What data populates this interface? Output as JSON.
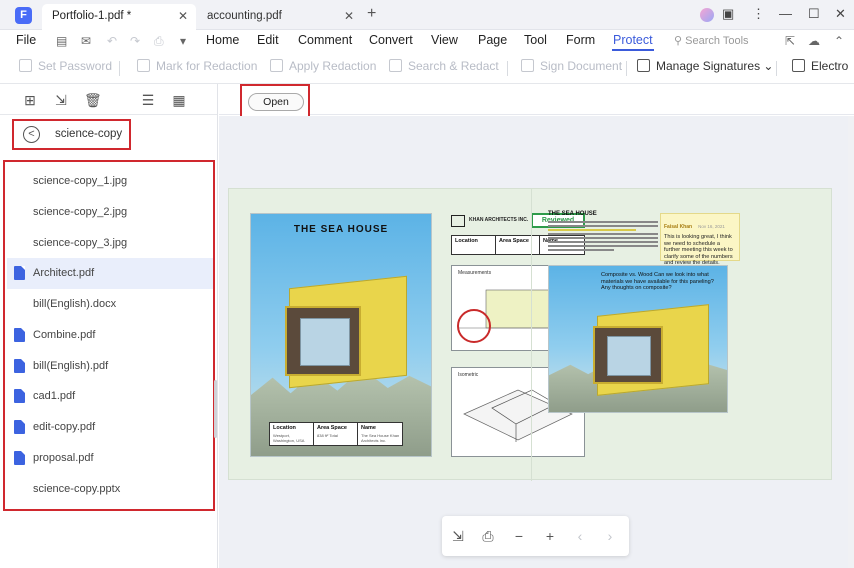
{
  "window": {
    "tabs": [
      {
        "label": "Portfolio-1.pdf *",
        "active": true
      },
      {
        "label": "accounting.pdf",
        "active": false
      }
    ],
    "controls": [
      "minimize",
      "maximize",
      "close"
    ]
  },
  "menubar": {
    "file_label": "File",
    "items": [
      "Home",
      "Edit",
      "Comment",
      "Convert",
      "View",
      "Page",
      "Tool",
      "Form",
      "Protect"
    ],
    "active_item": "Protect",
    "search_tools_label": "Search Tools"
  },
  "toolbar": {
    "set_password": "Set Password",
    "mark_for_redaction": "Mark for Redaction",
    "apply_redaction": "Apply Redaction",
    "search_redact": "Search & Redact",
    "sign_document": "Sign Document",
    "manage_signatures": "Manage Signatures",
    "manage_signatures_caret": "⌄",
    "electronic": "Electro"
  },
  "sidebar": {
    "folder_name": "science-copy",
    "files": [
      {
        "name": "science-copy_1.jpg",
        "type": "jpg"
      },
      {
        "name": "science-copy_2.jpg",
        "type": "jpg"
      },
      {
        "name": "science-copy_3.jpg",
        "type": "jpg"
      },
      {
        "name": "Architect.pdf",
        "type": "pdf",
        "selected": true
      },
      {
        "name": "bill(English).docx",
        "type": "docx"
      },
      {
        "name": "Combine.pdf",
        "type": "pdf"
      },
      {
        "name": "bill(English).pdf",
        "type": "pdf"
      },
      {
        "name": "cad1.pdf",
        "type": "pdf"
      },
      {
        "name": "edit-copy.pdf",
        "type": "pdf"
      },
      {
        "name": "proposal.pdf",
        "type": "pdf"
      },
      {
        "name": "science-copy.pptx",
        "type": "pptx"
      }
    ]
  },
  "main": {
    "open_label": "Open"
  },
  "document": {
    "left_title": "THE SEA HOUSE",
    "right_title": "THE SEA HOUSE",
    "table": {
      "location_label": "Location",
      "location_value": "Westport, Washington, USA",
      "area_label": "Area Space",
      "area_value": "838 ft² Total",
      "name_label": "Name",
      "name_value": "The Sea House Khan Architects Inc."
    },
    "logo_text": "KHAN ARCHITECTS INC.",
    "reviewed_stamp": "Reviewed",
    "measurements_label": "Measurements",
    "isometric_label": "Isometric",
    "note": {
      "author": "Faisal Khan",
      "date": "Nov 16, 2021",
      "text": "This is looking great, I think we need to schedule a further meeting this week to clarify some of the numbers and review the details."
    },
    "callout": "Composite vs. Wood Can we look into what materials we have available for this paneling? Any thoughts on composite?"
  },
  "colors": {
    "accent": "#3b5bdb",
    "highlight_frame": "#d0282e",
    "pdf_icon": "#3c63e0",
    "reviewed_green": "#2e9b4a"
  }
}
